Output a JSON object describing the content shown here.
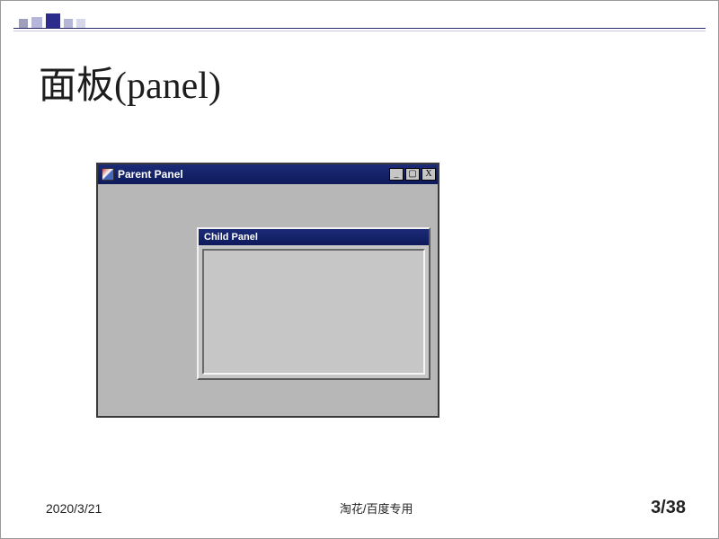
{
  "slide": {
    "title": "面板(panel)"
  },
  "parent_window": {
    "title": "Parent Panel",
    "buttons": {
      "min": "_",
      "max": "▢",
      "close": "X"
    }
  },
  "child_panel": {
    "title": "Child Panel"
  },
  "footer": {
    "date": "2020/3/21",
    "watermark": "淘花/百度专用",
    "pager": "3/38"
  }
}
